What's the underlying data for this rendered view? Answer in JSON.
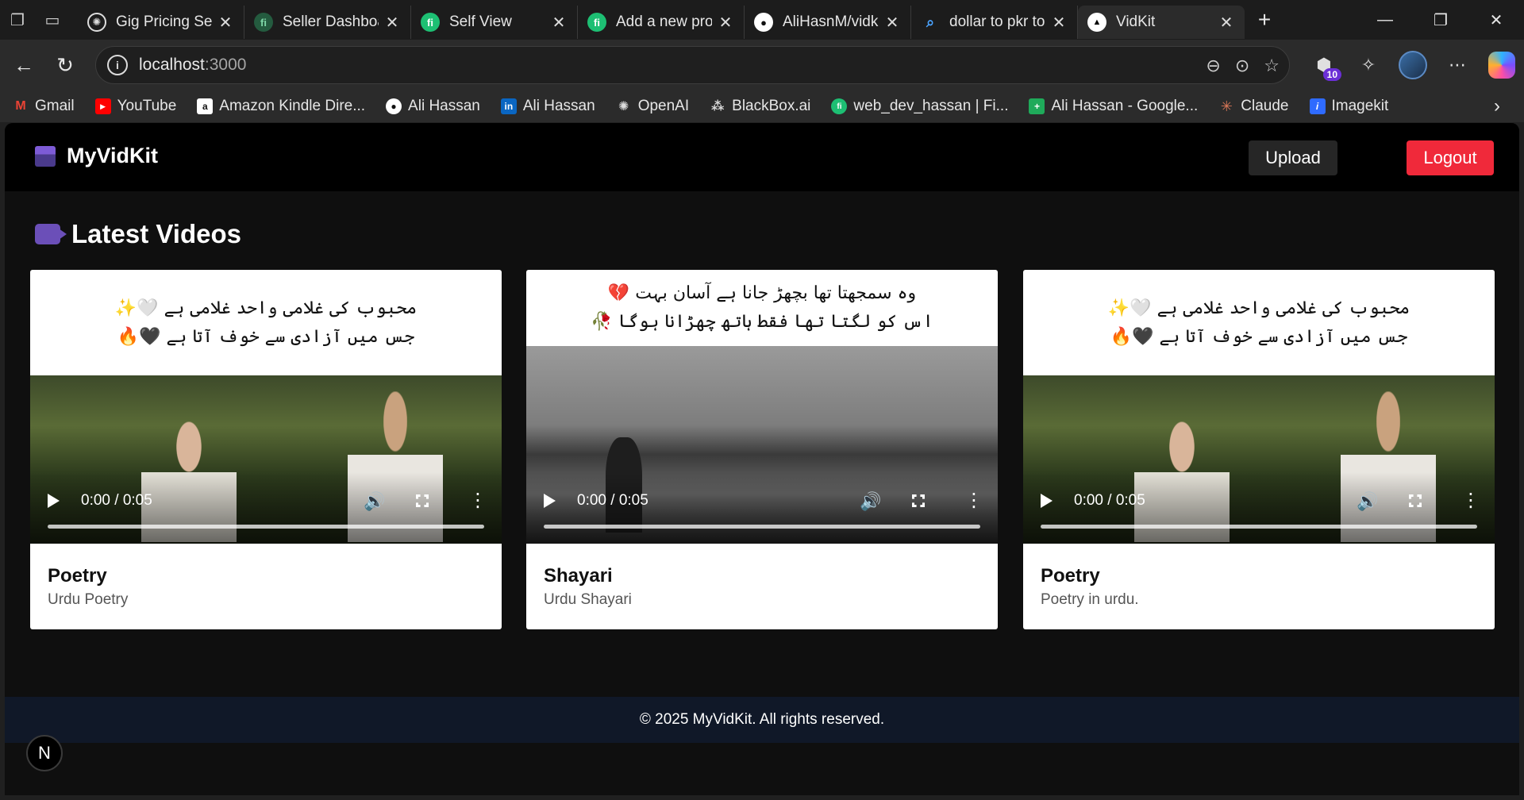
{
  "browser": {
    "tabs": [
      {
        "title": "Gig Pricing Set",
        "favicon": "openai-icon",
        "color": "#ffffff"
      },
      {
        "title": "Seller Dashboa",
        "favicon": "fiverr-icon",
        "color": "#1dbf73"
      },
      {
        "title": "Self View",
        "favicon": "fiverr-icon",
        "color": "#1dbf73"
      },
      {
        "title": "Add a new pro",
        "favicon": "fiverr-icon",
        "color": "#1dbf73"
      },
      {
        "title": "AliHasnM/vidk",
        "favicon": "github-icon",
        "color": "#ffffff"
      },
      {
        "title": "dollar to pkr to",
        "favicon": "search-icon",
        "color": "#4aa3ff"
      },
      {
        "title": "VidKit",
        "favicon": "vercel-icon",
        "color": "#ffffff",
        "active": true
      }
    ],
    "address": {
      "host": "localhost",
      "port": ":3000"
    },
    "extension_badge": "10",
    "bookmarks": [
      {
        "label": "Gmail",
        "icon": "gmail-icon",
        "color": "#ea4335"
      },
      {
        "label": "YouTube",
        "icon": "youtube-icon",
        "color": "#ff0000"
      },
      {
        "label": "Amazon Kindle Dire...",
        "icon": "amazon-icon",
        "color": "#ffffff"
      },
      {
        "label": "Ali Hassan",
        "icon": "github-icon",
        "color": "#ffffff"
      },
      {
        "label": "Ali Hassan",
        "icon": "linkedin-icon",
        "color": "#0a66c2"
      },
      {
        "label": "OpenAI",
        "icon": "openai-icon",
        "color": "#ffffff"
      },
      {
        "label": "BlackBox.ai",
        "icon": "blackbox-icon",
        "color": "#ffffff"
      },
      {
        "label": "web_dev_hassan | Fi...",
        "icon": "fiverr-icon",
        "color": "#1dbf73"
      },
      {
        "label": "Ali Hassan - Google...",
        "icon": "google-sheets-icon",
        "color": "#1faa5a"
      },
      {
        "label": "Claude",
        "icon": "claude-icon",
        "color": "#d97757"
      },
      {
        "label": "Imagekit",
        "icon": "imagekit-icon",
        "color": "#2f6bff"
      }
    ]
  },
  "site": {
    "brand": "MyVidKit",
    "upload_label": "Upload",
    "logout_label": "Logout",
    "section_title": "Latest Videos",
    "footer": "© 2025 MyVidKit. All rights reserved.",
    "next_badge": "N",
    "colors": {
      "logout": "#f0293a",
      "footer": "#101828"
    }
  },
  "videos": [
    {
      "title": "Poetry",
      "description": "Urdu Poetry",
      "caption_line1": "محبوب کی غلامی واحد غلامی ہے 🤍✨",
      "caption_line2": "جس میں آزادی سے خوف آتا ہے 🖤🔥",
      "time": "0:00 / 0:05"
    },
    {
      "title": "Shayari",
      "description": "Urdu Shayari",
      "caption_line1": "وہ سمجھتا تھا بچھڑ جانا ہے آسان بہت 💔",
      "caption_line2": "اس کو لگتا تھا فقط ہاتھ چھڑانا ہوگا 🥀",
      "time": "0:00 / 0:05"
    },
    {
      "title": "Poetry",
      "description": "Poetry in urdu.",
      "caption_line1": "محبوب کی غلامی واحد غلامی ہے 🤍✨",
      "caption_line2": "جس میں آزادی سے خوف آتا ہے 🖤🔥",
      "time": "0:00 / 0:05"
    }
  ]
}
